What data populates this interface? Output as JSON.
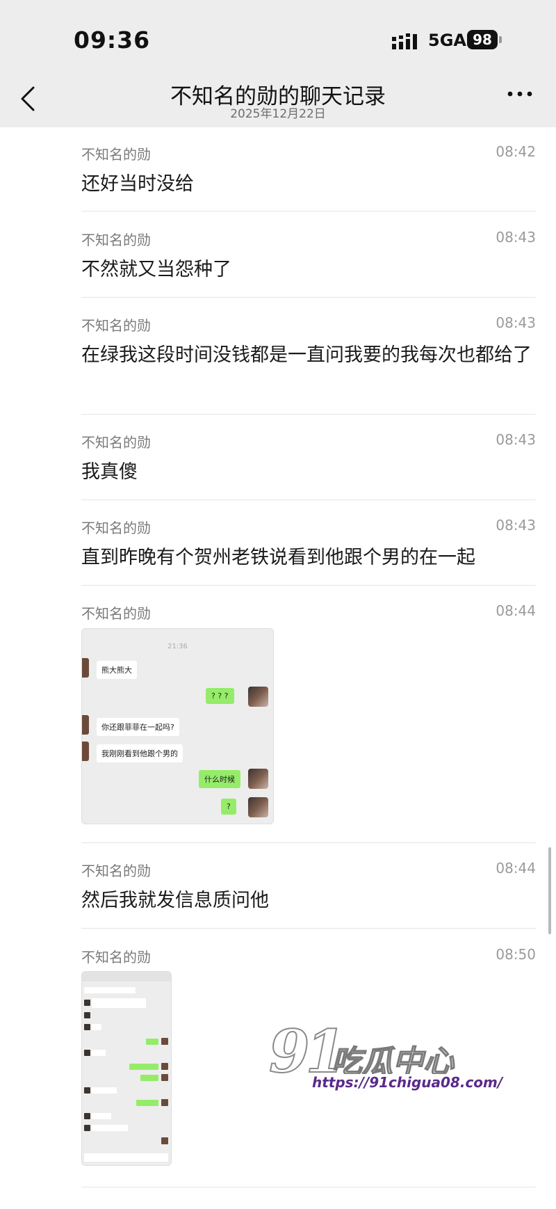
{
  "status_bar": {
    "time": "09:36",
    "network": "5GA",
    "battery": "98"
  },
  "header": {
    "title": "不知名的勋的聊天记录",
    "date": "2025年12月22日"
  },
  "messages": [
    {
      "sender": "不知名的勋",
      "time": "08:42",
      "text": "还好当时没给"
    },
    {
      "sender": "不知名的勋",
      "time": "08:43",
      "text": "不然就又当怨种了"
    },
    {
      "sender": "不知名的勋",
      "time": "08:43",
      "text": "在绿我这段时间没钱都是一直问我要的我每次也都给了"
    },
    {
      "sender": "不知名的勋",
      "time": "08:43",
      "text": "我真傻"
    },
    {
      "sender": "不知名的勋",
      "time": "08:43",
      "text": "直到昨晚有个贺州老铁说看到他跟个男的在一起"
    },
    {
      "sender": "不知名的勋",
      "time": "08:44"
    },
    {
      "sender": "不知名的勋",
      "time": "08:44",
      "text": "然后我就发信息质问他"
    },
    {
      "sender": "不知名的勋",
      "time": "08:50"
    }
  ],
  "image1": {
    "time": "21:36",
    "bubbles": [
      "熊大熊大",
      "? ? ?",
      "你还跟菲菲在一起吗?",
      "我刚刚看到他跟个男的",
      "什么时候",
      "?"
    ]
  },
  "watermark": {
    "logo": "91",
    "name": "吃瓜中心",
    "url": "https://91chigua08.com/"
  },
  "icons": [
    "back-chevron-icon",
    "more-dots-icon",
    "signal-icon",
    "battery-icon"
  ]
}
